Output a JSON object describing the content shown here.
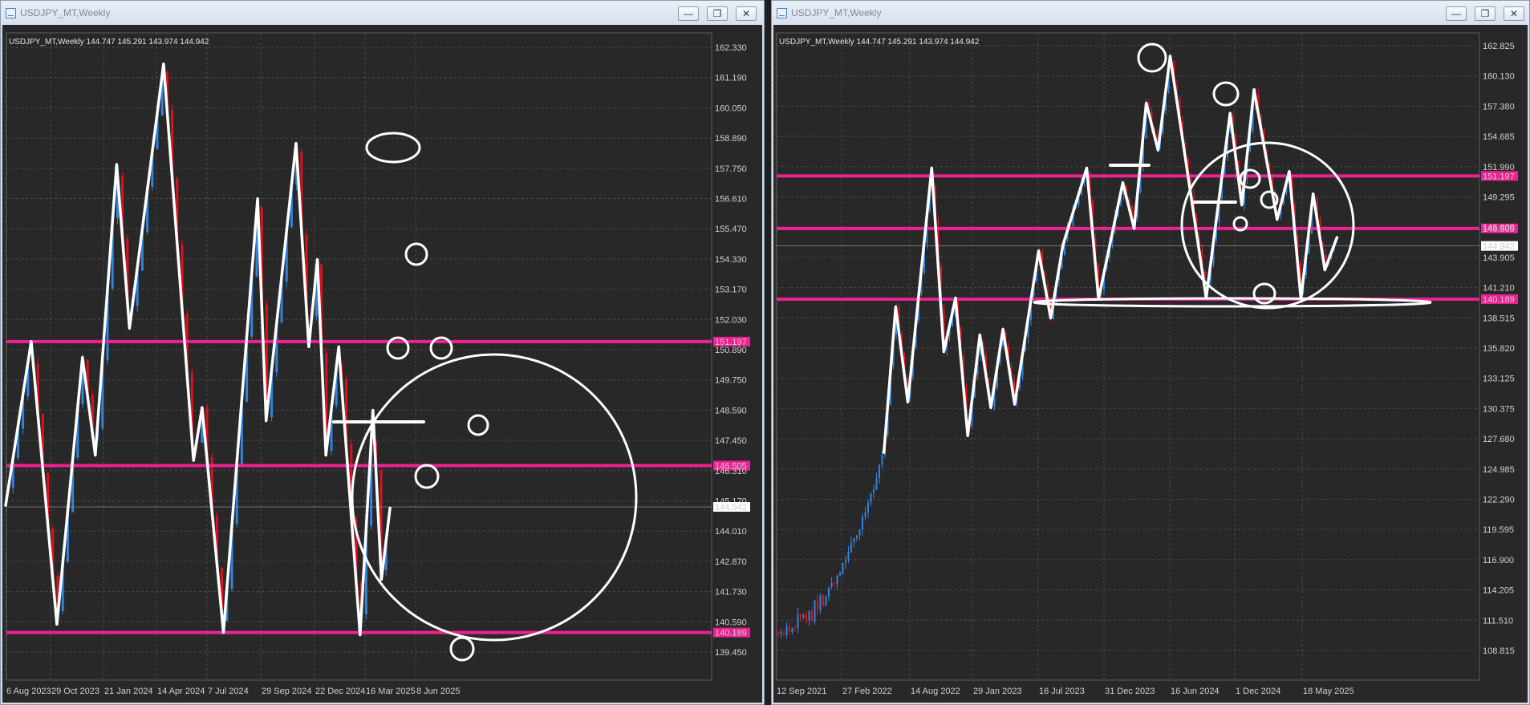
{
  "left_window": {
    "title": "USDJPY_MT,Weekly",
    "controls": {
      "minimize": "—",
      "maximize": "❐",
      "close": "✕"
    },
    "header_text": "USDJPY_MT,Weekly  144.747 145.291 143.974 144.942",
    "current_price_label": "144.942"
  },
  "right_window": {
    "title": "USDJPY_MT,Weekly",
    "controls": {
      "minimize": "—",
      "maximize": "❐",
      "close": "✕"
    },
    "header_text": "USDJPY_MT,Weekly  144.747 145.291 143.974 144.942",
    "current_price_label": "144.942"
  },
  "colors": {
    "background": "#282828",
    "bull": "#2f84e0",
    "bear": "#e0101e",
    "level": "#ee2192",
    "drawing": "#ffffff"
  },
  "chart_data": [
    {
      "type": "candlestick",
      "title": "USDJPY_MT,Weekly",
      "ohlc": [
        144.747,
        145.291,
        143.974,
        144.942
      ],
      "y_ticks": [
        "162.330",
        "161.190",
        "160.050",
        "158.890",
        "157.750",
        "156.610",
        "155.470",
        "154.330",
        "153.170",
        "152.030",
        "150.890",
        "149.750",
        "148.590",
        "147.450",
        "146.310",
        "145.170",
        "144.010",
        "142.870",
        "141.730",
        "140.590",
        "139.450"
      ],
      "ylim": [
        139.0,
        163.0
      ],
      "x_ticks": [
        "6 Aug 2023",
        "29 Oct 2023",
        "21 Jan 2024",
        "14 Apr 2024",
        "7 Jul 2024",
        "29 Sep 2024",
        "22 Dec 2024",
        "16 Mar 2025",
        "8 Jun 2025"
      ],
      "levels": [
        {
          "value": 151.197,
          "label": "151.197"
        },
        {
          "value": 146.505,
          "label": "146.505"
        },
        {
          "value": 140.189,
          "label": "140.189"
        }
      ],
      "last_price": 144.942,
      "swing_path": [
        [
          "6 Aug 2023",
          145.0
        ],
        [
          "17 Sep 2023",
          151.2
        ],
        [
          "29 Oct 2023",
          140.5
        ],
        [
          "10 Dec 2023",
          150.6
        ],
        [
          "31 Dec 2023",
          146.9
        ],
        [
          "4 Feb 2024",
          157.9
        ],
        [
          "25 Feb 2024",
          151.7
        ],
        [
          "21 Apr 2024",
          161.7
        ],
        [
          "9 Jun 2024",
          146.7
        ],
        [
          "23 Jun 2024",
          148.7
        ],
        [
          "28 Jul 2024",
          140.2
        ],
        [
          "22 Sep 2024",
          156.6
        ],
        [
          "6 Oct 2024",
          148.2
        ],
        [
          "24 Nov 2024",
          158.7
        ],
        [
          "15 Dec 2024",
          151.0
        ],
        [
          "29 Dec 2024",
          154.3
        ],
        [
          "12 Jan 2025",
          146.9
        ],
        [
          "2 Feb 2025",
          151.0
        ],
        [
          "9 Mar 2025",
          140.1
        ],
        [
          "30 Mar 2025",
          148.6
        ],
        [
          "13 Apr 2025",
          142.2
        ],
        [
          "27 Apr 2025",
          144.9
        ]
      ]
    },
    {
      "type": "candlestick",
      "title": "USDJPY_MT,Weekly",
      "ohlc": [
        144.747,
        145.291,
        143.974,
        144.942
      ],
      "y_ticks": [
        "162.825",
        "160.130",
        "157.380",
        "154.685",
        "151.990",
        "149.295",
        "146.600",
        "143.905",
        "141.210",
        "138.515",
        "135.820",
        "133.125",
        "130.375",
        "127.680",
        "124.985",
        "122.290",
        "119.595",
        "116.900",
        "114.205",
        "111.510",
        "108.815"
      ],
      "ylim": [
        107.5,
        164.0
      ],
      "x_ticks": [
        "12 Sep 2021",
        "27 Feb 2022",
        "14 Aug 2022",
        "29 Jan 2023",
        "16 Jul 2023",
        "31 Dec 2023",
        "16 Jun 2024",
        "1 Dec 2024",
        "18 May 2025"
      ],
      "levels": [
        {
          "value": 151.197,
          "label": "151.197"
        },
        {
          "value": 146.505,
          "label": "146.505"
        },
        {
          "value": 140.189,
          "label": "140.189"
        }
      ],
      "last_price": 144.942,
      "swing_path": [
        [
          "Jun 2022",
          126.5
        ],
        [
          "Jul 2022",
          139.5
        ],
        [
          "Aug 2022",
          131.0
        ],
        [
          "Oct 2022",
          151.9
        ],
        [
          "Nov 2022",
          135.5
        ],
        [
          "Dec 2022",
          140.3
        ],
        [
          "Jan 2023",
          128.0
        ],
        [
          "Feb 2023",
          137.0
        ],
        [
          "Mar 2023",
          130.5
        ],
        [
          "Apr 2023",
          137.5
        ],
        [
          "May 2023",
          130.8
        ],
        [
          "Jul 2023",
          144.5
        ],
        [
          "Aug 2023",
          138.5
        ],
        [
          "Sep 2023",
          145.0
        ],
        [
          "Nov 2023",
          151.9
        ],
        [
          "Dec 2023",
          140.2
        ],
        [
          "Feb 2024",
          150.6
        ],
        [
          "Mar 2024",
          146.5
        ],
        [
          "Apr 2024",
          157.7
        ],
        [
          "May 2024",
          153.5
        ],
        [
          "Jun 2024",
          161.9
        ],
        [
          "Sep 2024",
          140.3
        ],
        [
          "Nov 2024",
          156.8
        ],
        [
          "Dec 2024",
          148.6
        ],
        [
          "Jan 2025",
          158.9
        ],
        [
          "Mar 2025",
          147.3
        ],
        [
          "Apr 2025",
          151.6
        ],
        [
          "May 2025",
          140.2
        ],
        [
          "Jun 2025",
          149.6
        ],
        [
          "Jul 2025",
          142.8
        ],
        [
          "Aug 2025",
          145.7
        ]
      ]
    }
  ]
}
